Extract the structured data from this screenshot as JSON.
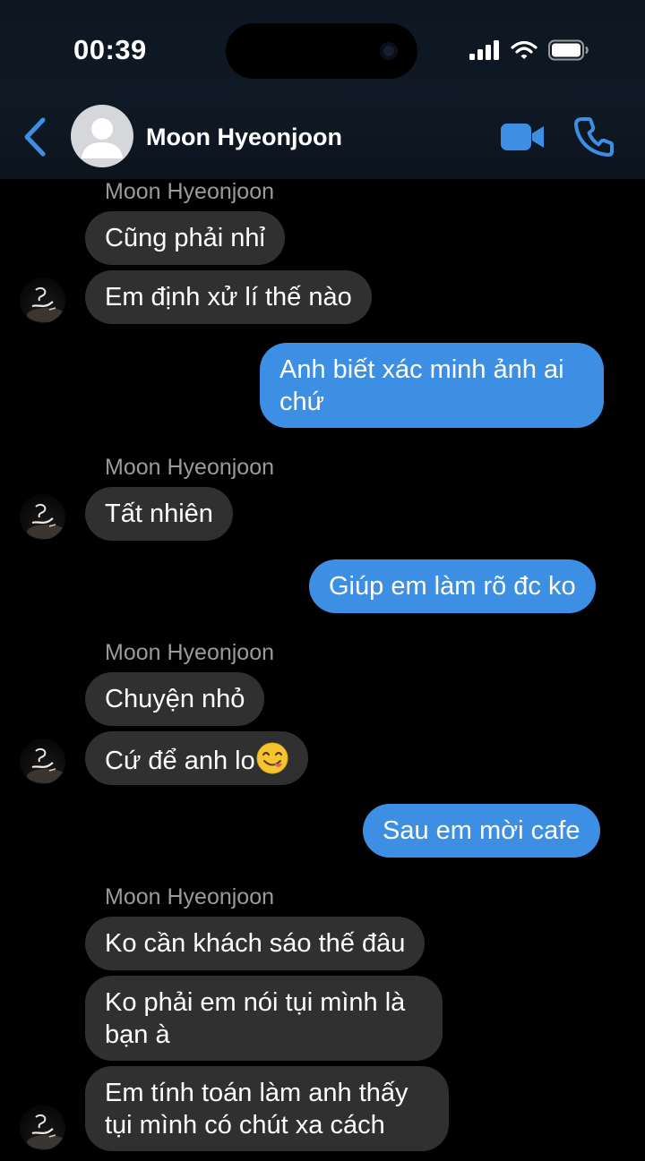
{
  "status_bar": {
    "time": "00:39"
  },
  "header": {
    "back_icon": "chevron-left-icon",
    "contact_name": "Moon Hyeonjoon",
    "video_icon": "video-camera-icon",
    "call_icon": "phone-icon",
    "accent_color": "#3c8fe3"
  },
  "messages": {
    "group1": {
      "sender": "Moon Hyeonjoon",
      "m1": "Cũng phải nhỉ",
      "m2": "Em định xử lí thế nào"
    },
    "out1": {
      "line1": "Anh biết xác minh ảnh ai",
      "line2": "chứ"
    },
    "group2": {
      "sender": "Moon Hyeonjoon",
      "m1": "Tất nhiên"
    },
    "out2": "Giúp em làm rõ đc ko",
    "group3": {
      "sender": "Moon Hyeonjoon",
      "m1": "Chuyện nhỏ",
      "m2": "Cứ để anh lo",
      "m2_emoji": "yum-face-icon"
    },
    "out3": "Sau em mời cafe",
    "group4": {
      "sender": "Moon Hyeonjoon",
      "m1": "Ko cần khách sáo thế đâu",
      "m2_line1": "Ko phải em nói tụi mình là",
      "m2_line2": "bạn à",
      "m3_line1": "Em tính toán làm anh thấy",
      "m3_line2": "tụi mình có chút xa cách"
    }
  },
  "colors": {
    "incoming_bubble": "#303030",
    "outgoing_bubble": "#3c8fe3",
    "background": "#000000"
  }
}
